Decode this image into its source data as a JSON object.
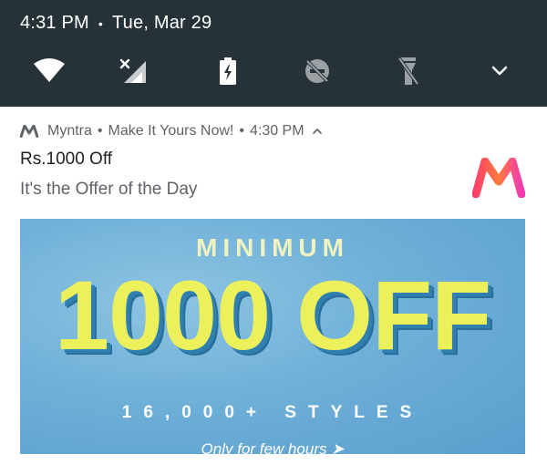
{
  "status_bar": {
    "time": "4:31 PM",
    "separator": "•",
    "date": "Tue, Mar 29"
  },
  "quick_settings": [
    {
      "name": "wifi-icon",
      "state": "on"
    },
    {
      "name": "cellular-icon",
      "state": "no-signal"
    },
    {
      "name": "battery-icon",
      "state": "charging"
    },
    {
      "name": "do-not-disturb-icon",
      "state": "off"
    },
    {
      "name": "flashlight-icon",
      "state": "off"
    },
    {
      "name": "expand-chevron-icon",
      "state": "collapsed"
    }
  ],
  "notification": {
    "app_name": "Myntra",
    "separator": "•",
    "subtext": "Make It Yours Now!",
    "time": "4:30 PM",
    "title": "Rs.1000 Off",
    "text": "It's the Offer of the Day",
    "banner": {
      "line1": "MINIMUM",
      "headline": "1000 OFF",
      "line2": "16,000+ STYLES",
      "cta": "Only for few hours ➤"
    }
  },
  "colors": {
    "panel": "#263238",
    "banner_bg": "#6fb0d8",
    "headline": "#ecf05a"
  }
}
